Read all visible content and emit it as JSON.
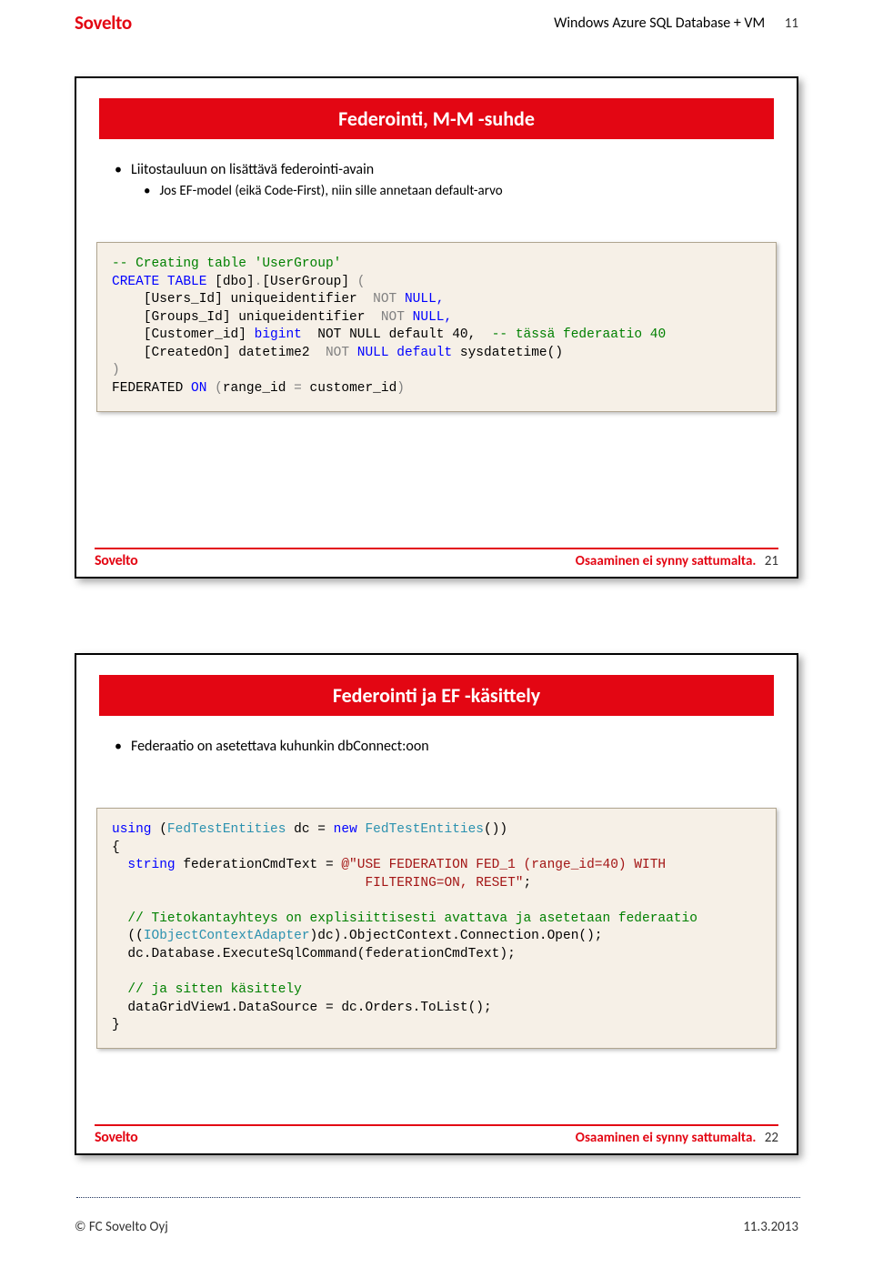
{
  "brand": "Sovelto",
  "header": {
    "title": "Windows Azure SQL Database + VM",
    "page": "11"
  },
  "slide1": {
    "title": "Federointi, M-M -suhde",
    "b1": "Liitostauluun on lisättävä federointi-avain",
    "b2": "Jos EF-model (eikä Code-First), niin sille annetaan default-arvo",
    "code": {
      "c1": "-- Creating table 'UserGroup'",
      "c2a": "CREATE",
      "c2b": " TABLE",
      "c2c": " [dbo]",
      "c2d": ".",
      "c2e": "[UserGroup]",
      "c2f": " (",
      "c3a": "    [Users_Id] uniqueidentifier  ",
      "c3b": "NOT",
      "c3c": " NULL,",
      "c4a": "    [Groups_Id] uniqueidentifier  ",
      "c4b": "NOT",
      "c4c": " NULL,",
      "c5a": "    [Customer_id] ",
      "c5b": "bigint",
      "c5c": "  NOT NULL default",
      "c5d": " 40,  ",
      "c5e": "-- tässä federaatio 40",
      "c6a": "    [CreatedOn] datetime2  ",
      "c6b": "NOT",
      "c6c": " NULL",
      "c6d": " default",
      "c6e": " sysdatetime()",
      "c7": ")",
      "c8a": "FEDERATED ",
      "c8b": "ON",
      "c8c": " (",
      "c8d": "range_id ",
      "c8e": "=",
      "c8f": " customer_id",
      "c8g": ")"
    },
    "footer_tag": "Osaaminen ei synny sattumalta.",
    "num": "21"
  },
  "slide2": {
    "title": "Federointi ja EF -käsittely",
    "b1": "Federaatio on asetettava kuhunkin dbConnect:oon",
    "code": {
      "l1a": "using",
      "l1b": " (",
      "l1c": "FedTestEntities",
      "l1d": " dc = ",
      "l1e": "new",
      "l1f": " ",
      "l1g": "FedTestEntities",
      "l1h": "())",
      "l2": "{",
      "l3a": "  ",
      "l3b": "string",
      "l3c": " federationCmdText = ",
      "l3d": "@\"USE FEDERATION FED_1 (range_id=40) WITH",
      "l3e": "                                FILTERING=ON, RESET\"",
      "l3f": ";",
      "l5": "  // Tietokantayhteys on explisiittisesti avattava ja asetetaan federaatio",
      "l6a": "  ((",
      "l6b": "IObjectContextAdapter",
      "l6c": ")dc).ObjectContext.Connection.Open();",
      "l7": "  dc.Database.ExecuteSqlCommand(federationCmdText);",
      "l9": "  // ja sitten käsittely",
      "l10": "  dataGridView1.DataSource = dc.Orders.ToList();",
      "l11": "}"
    },
    "footer_tag": "Osaaminen ei synny sattumalta.",
    "num": "22"
  },
  "doc_footer": {
    "left": "© FC Sovelto Oyj",
    "right": "11.3.2013"
  }
}
